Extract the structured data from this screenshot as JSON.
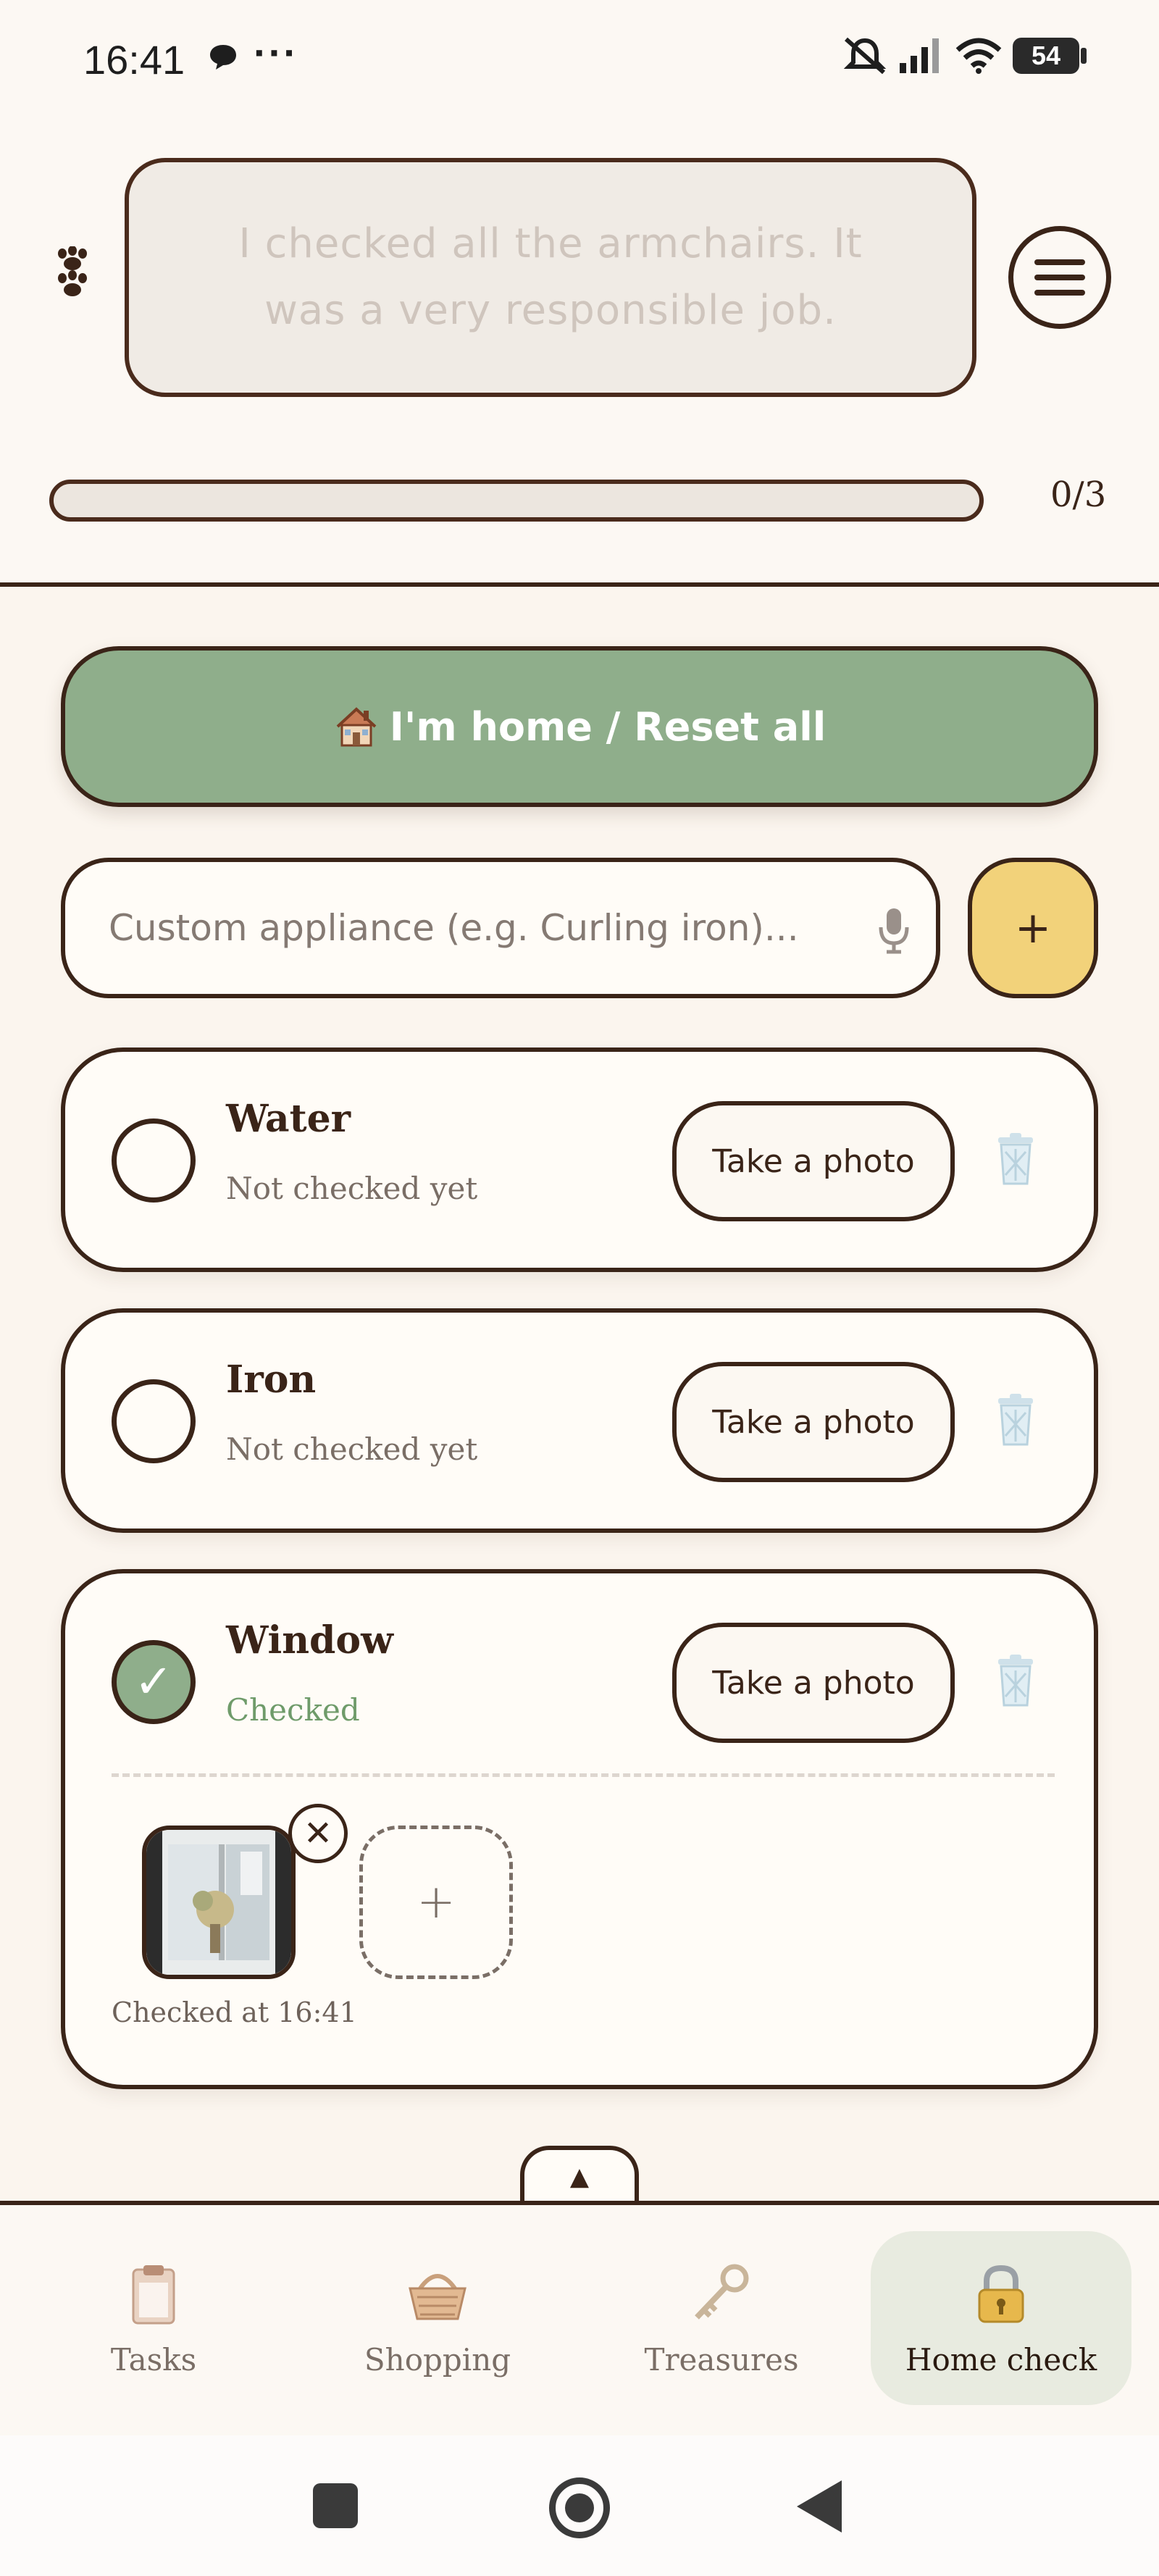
{
  "status_bar": {
    "time": "16:41",
    "dots": "···",
    "battery": "54"
  },
  "header": {
    "quote": "I checked all the armchairs. It was a very responsible job.",
    "progress_label": "0/3",
    "progress_fraction": 0
  },
  "actions": {
    "reset_label": "I'm home / Reset all",
    "input_placeholder": "Custom appliance (e.g. Curling iron)...",
    "add_label": "+"
  },
  "items": [
    {
      "name": "Water",
      "status": "Not checked yet",
      "photo_button": "Take a photo",
      "checked": false
    },
    {
      "name": "Iron",
      "status": "Not checked yet",
      "photo_button": "Take a photo",
      "checked": false
    },
    {
      "name": "Window",
      "status": "Checked",
      "photo_button": "Take a photo",
      "checked": true,
      "checked_at": "Checked at 16:41"
    }
  ],
  "nav": {
    "tasks": "Tasks",
    "shopping": "Shopping",
    "treasures": "Treasures",
    "home_check": "Home check",
    "active": "home_check"
  },
  "colors": {
    "accent_green": "#8fae8b",
    "accent_yellow": "#f2d27a",
    "outline_brown": "#3a2418",
    "background": "#fbf5ee"
  }
}
